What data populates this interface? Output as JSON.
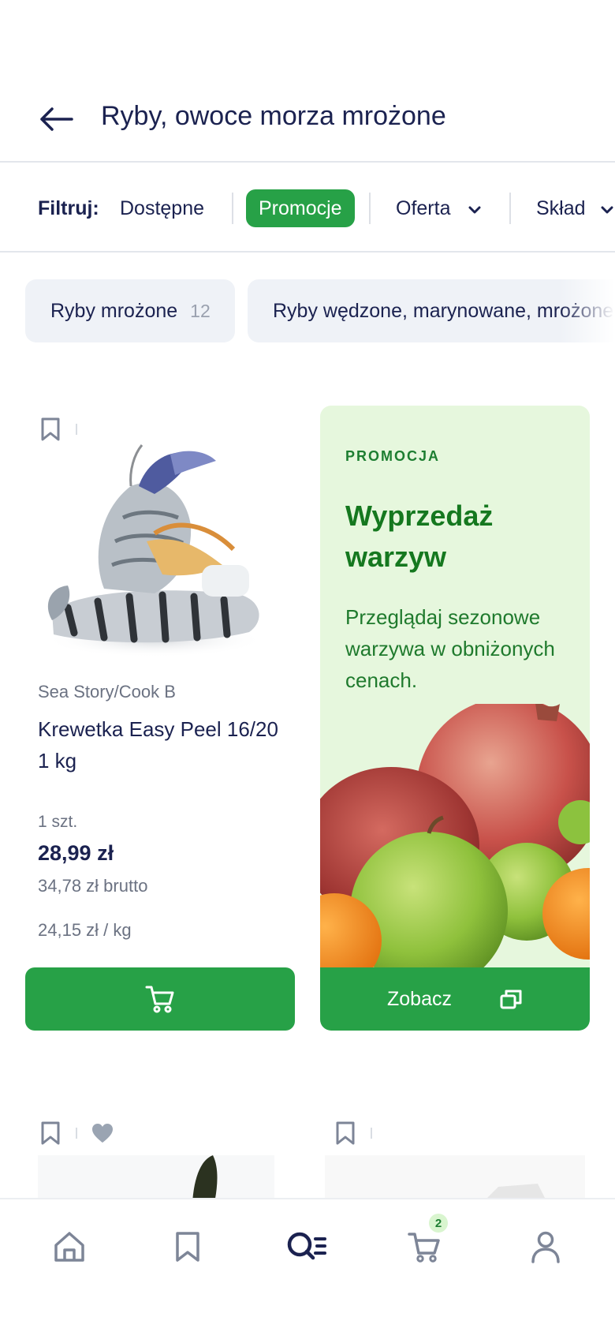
{
  "header": {
    "title": "Ryby, owoce morza mrożone"
  },
  "filters": {
    "label": "Filtruj:",
    "available": "Dostępne",
    "promotions": "Promocje",
    "offer": "Oferta",
    "composition": "Skład"
  },
  "categories": [
    {
      "label": "Ryby mrożone",
      "count": "12"
    },
    {
      "label": "Ryby wędzone, marynowane, mrożone",
      "count": ""
    }
  ],
  "product": {
    "brand": "Sea Story/Cook B",
    "name": "Krewetka Easy Peel 16/20 1 kg",
    "unit": "1 szt.",
    "price": "28,99 zł",
    "gross": "34,78 zł brutto",
    "per_kg": "24,15 zł / kg"
  },
  "promo": {
    "eyebrow": "PROMOCJA",
    "title": "Wyprzedaż warzyw",
    "description": "Przeglądaj sezonowe warzywa w obniżonych cenach.",
    "button": "Zobacz"
  },
  "bottom_nav": {
    "cart_badge": "2"
  },
  "colors": {
    "accent": "#27a147",
    "text": "#1b2250",
    "promo_bg": "#e6f7dd",
    "muted": "#6b7282"
  }
}
